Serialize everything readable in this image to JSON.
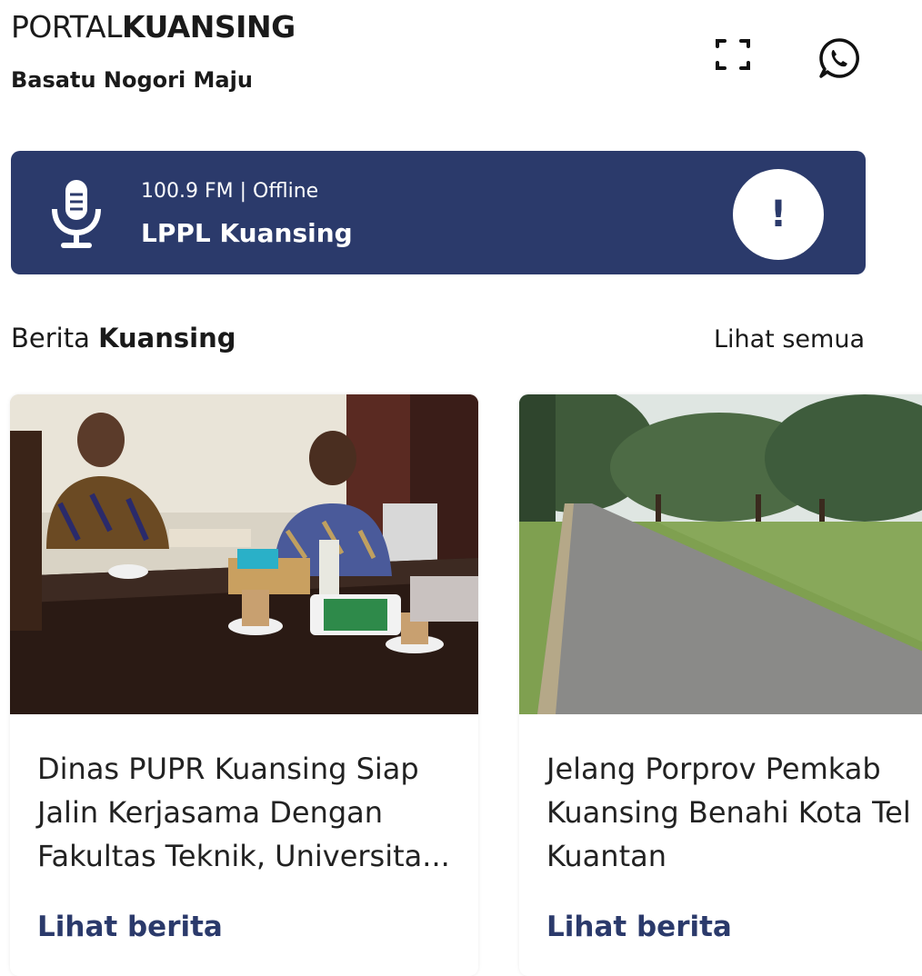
{
  "header": {
    "brand_light": "PORTAL",
    "brand_bold": "KUANSING",
    "tagline": "Basatu Nogori Maju",
    "icons": [
      "fullscreen-icon",
      "whatsapp-icon"
    ]
  },
  "radio": {
    "frequency": "100.9 FM | Offline",
    "station": "LPPL Kuansing",
    "alert_symbol": "!",
    "bg_color": "#2b3a6b"
  },
  "news_section": {
    "title_light": "Berita ",
    "title_bold": "Kuansing",
    "see_all": "Lihat semua"
  },
  "articles": [
    {
      "title_lines": [
        "Dinas PUPR Kuansing Siap",
        "Jalin Kerjasama Dengan",
        "Fakultas Teknik, Universita..."
      ],
      "link": "Lihat berita"
    },
    {
      "title_lines": [
        "Jelang Porprov Pemkab",
        "Kuansing Benahi Kota Tel",
        "Kuantan"
      ],
      "link": "Lihat berita"
    }
  ]
}
